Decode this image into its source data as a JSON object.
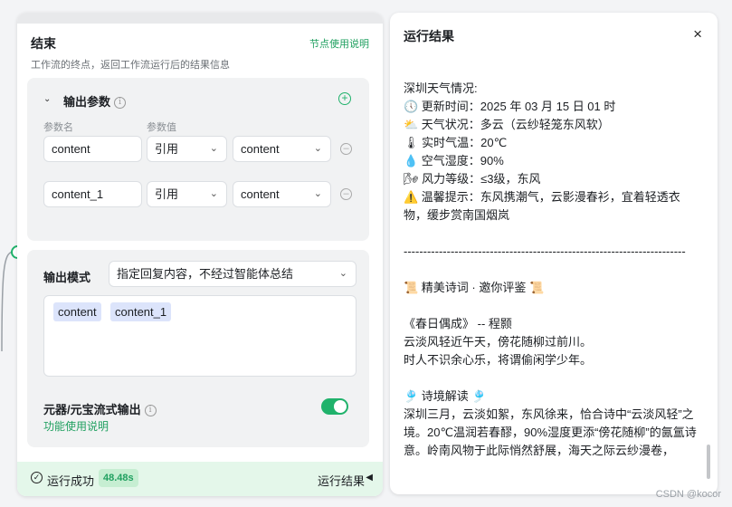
{
  "node": {
    "title": "结束",
    "doc_link": "节点使用说明",
    "description": "工作流的终点，返回工作流运行后的结果信息",
    "params": {
      "title": "输出参数",
      "info_icon": "info-icon",
      "col_name": "参数名",
      "col_value": "参数值",
      "rows": [
        {
          "name": "content",
          "type": "引用",
          "value": "content"
        },
        {
          "name": "content_1",
          "type": "引用",
          "value": "content"
        }
      ]
    },
    "output_mode": {
      "label": "输出模式",
      "selected": "指定回复内容，不经过智能体总结",
      "chips": [
        "content",
        "content_1"
      ]
    },
    "streaming": {
      "label": "元器/元宝流式输出",
      "link": "功能使用说明",
      "enabled": true
    },
    "status": {
      "text": "运行成功",
      "time": "48.48s",
      "result_button": "运行结果"
    }
  },
  "result_panel": {
    "title": "运行结果",
    "close": "×",
    "lines": [
      "深圳天气情况:",
      "🕔 更新时间：2025 年 03 月 15 日 01 时",
      "⛅ 天气状况：多云（云纱轻笼东风软）",
      "🌡 实时气温：20℃",
      "💧 空气湿度：90%",
      "🌬 风力等级：≤3级，东风",
      "⚠️ 温馨提示：东风携潮气，云影漫春衫，宜着轻透衣物，缓步赏南国烟岚",
      "",
      "------------------------------------------------------------------------",
      "",
      "📜 精美诗词 · 邀你评鉴 📜",
      "",
      "《春日偶成》 -- 程颢",
      "云淡风轻近午天，傍花随柳过前川。",
      "时人不识余心乐，将谓偷闲学少年。",
      "",
      "🎐 诗境解读 🎐",
      "深圳三月，云淡如絮，东风徐来，恰合诗中“云淡风轻”之境。20℃温润若春醪，90%湿度更添“傍花随柳”的氤氲诗意。岭南风物于此际悄然舒展，海天之际云纱漫卷，"
    ]
  },
  "watermark": "CSDN @kocor"
}
